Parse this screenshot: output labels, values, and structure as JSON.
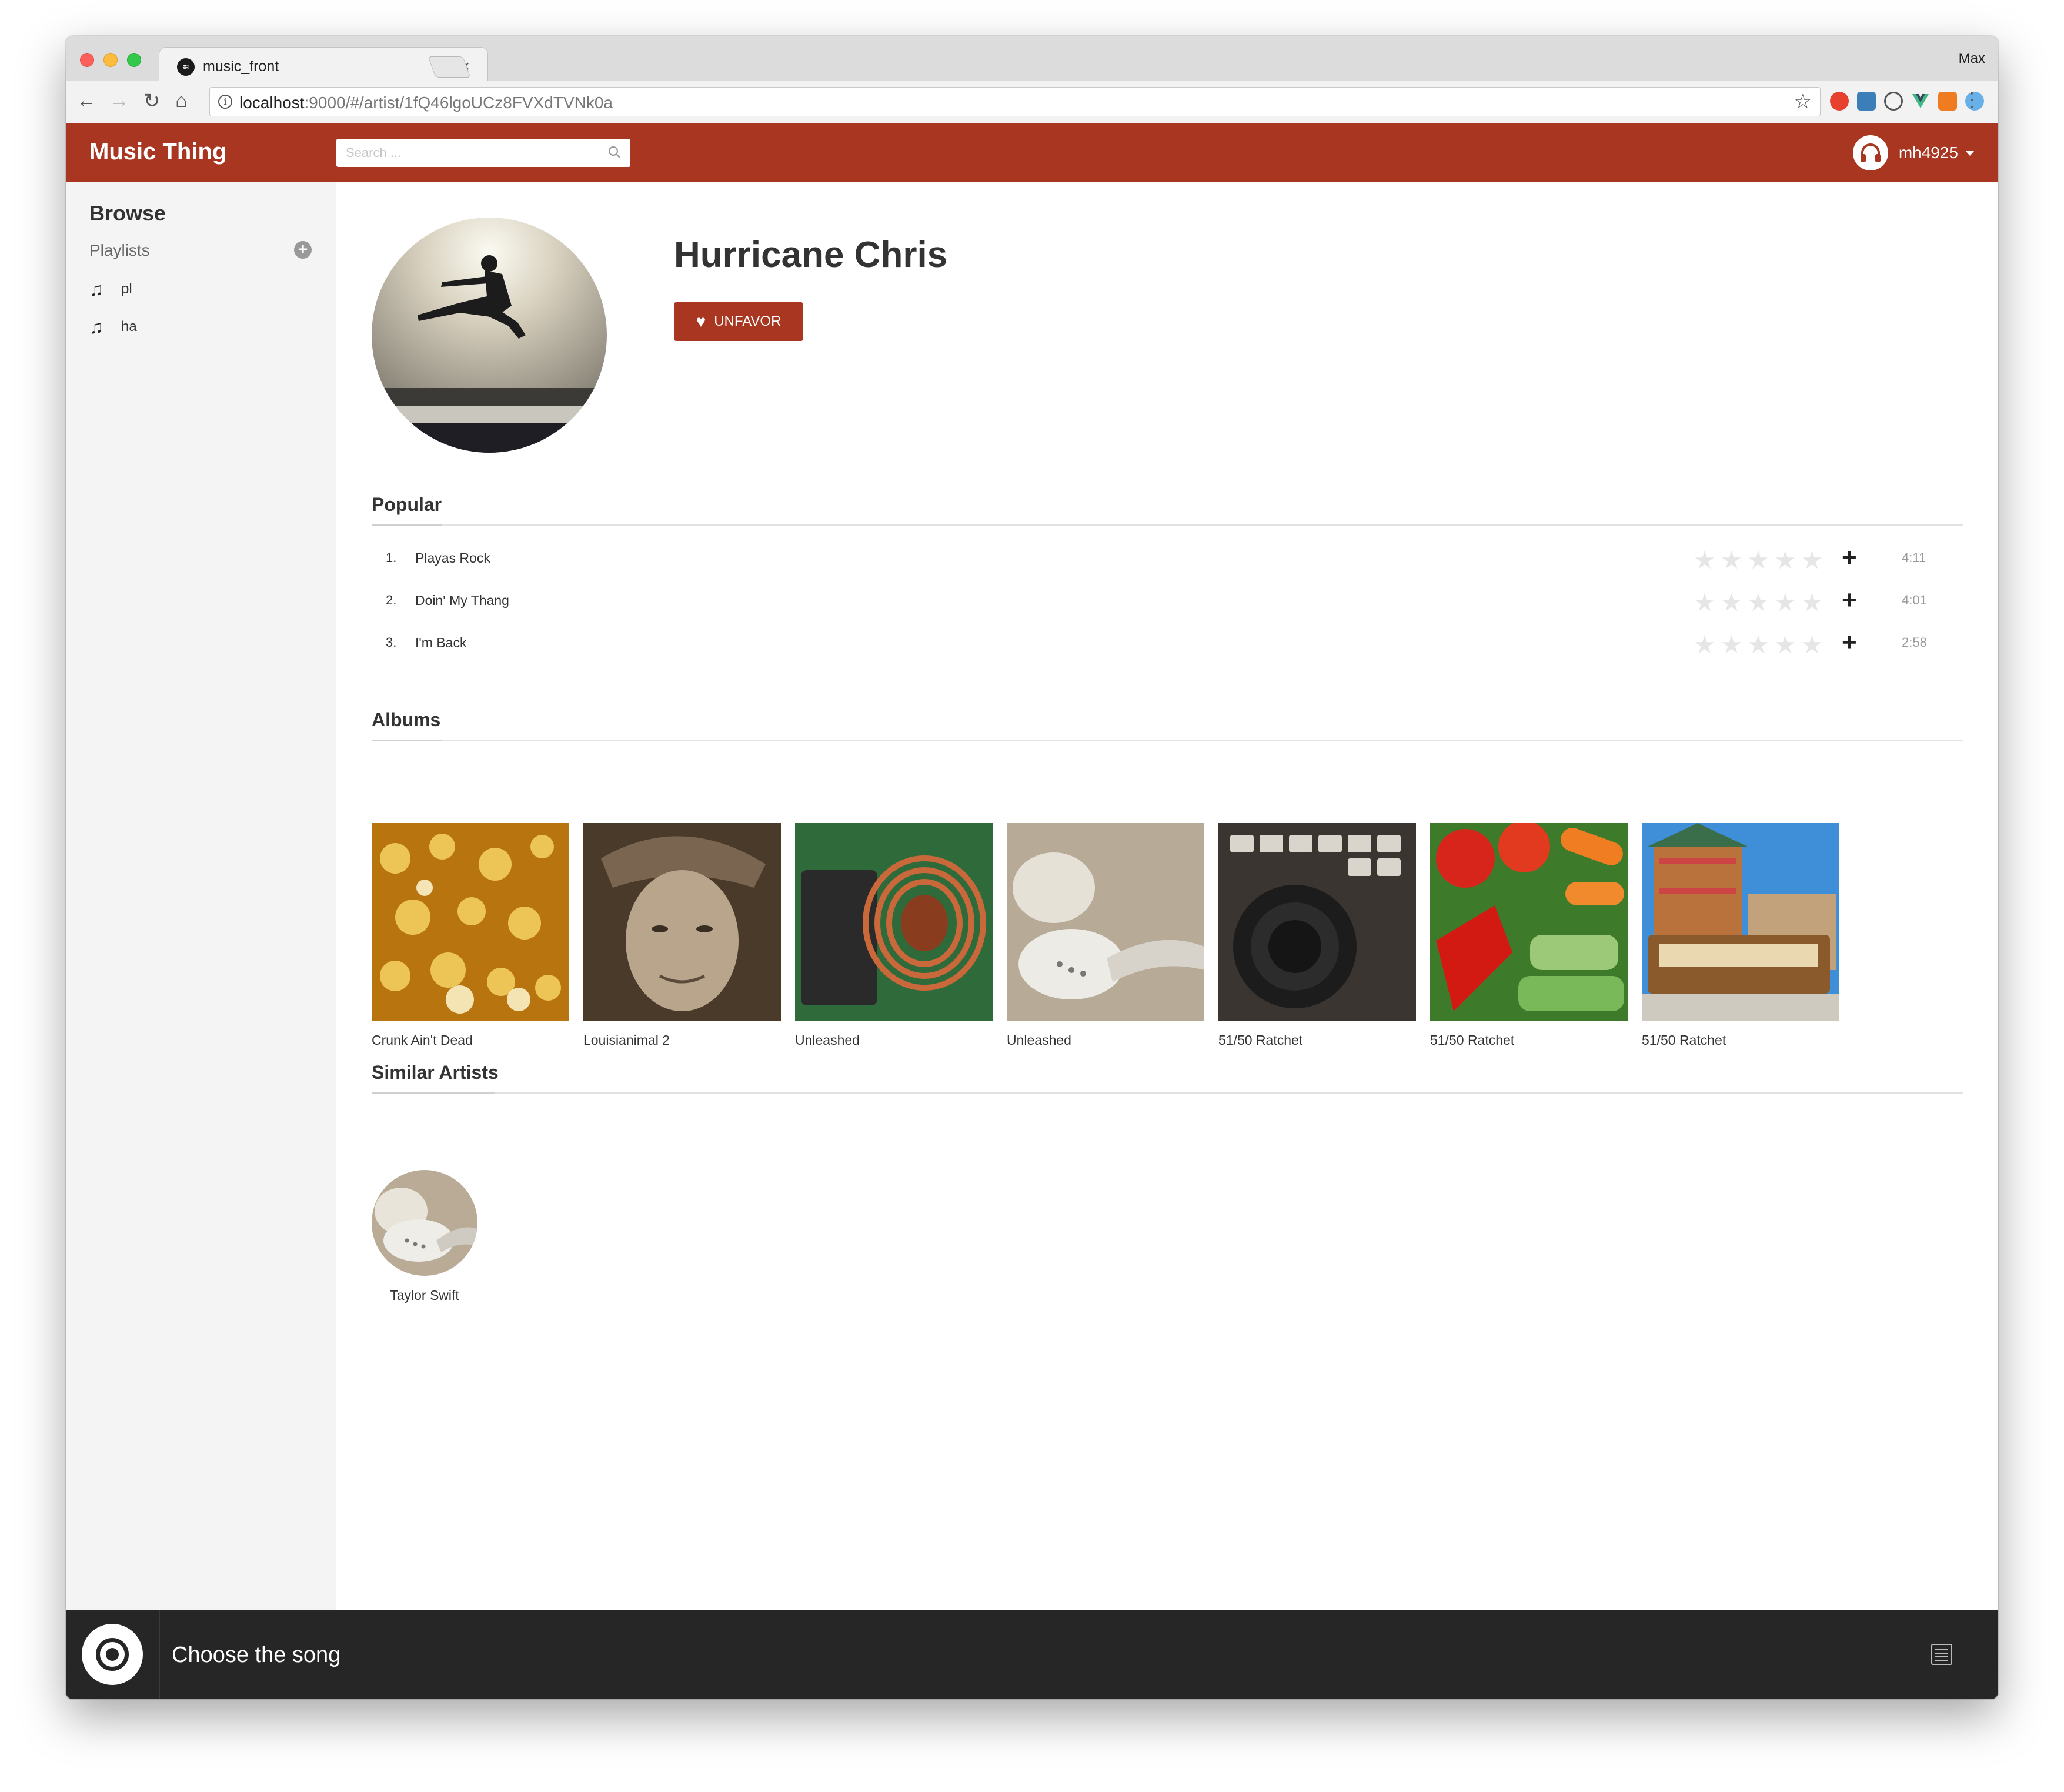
{
  "browser": {
    "tab_title": "music_front",
    "tab_close": "×",
    "profile_name": "Max",
    "url_host": "localhost",
    "url_rest": ":9000/#/artist/1fQ46lgoUCz8FVXdTVNk0a",
    "back": "←",
    "forward": "→",
    "reload": "↻",
    "home": "⌂",
    "star": "☆",
    "menu": "⋮"
  },
  "app": {
    "brand": "Music Thing",
    "search_placeholder": "Search ...",
    "username": "mh4925",
    "accent_color": "#a83621"
  },
  "sidebar": {
    "browse": "Browse",
    "playlists_label": "Playlists",
    "add": "+",
    "items": [
      {
        "icon": "music-note-icon",
        "label": "pl"
      },
      {
        "icon": "music-note-icon",
        "label": "ha"
      }
    ]
  },
  "artist": {
    "name": "Hurricane Chris",
    "unfavor_label": "UNFAVOR"
  },
  "popular": {
    "title": "Popular",
    "tracks": [
      {
        "num": "1.",
        "title": "Playas Rock",
        "stars": "★★★★★",
        "rating": 0,
        "add": "+",
        "duration": "4:11"
      },
      {
        "num": "2.",
        "title": "Doin' My Thang",
        "stars": "★★★★★",
        "rating": 0,
        "add": "+",
        "duration": "4:01"
      },
      {
        "num": "3.",
        "title": "I'm Back",
        "stars": "★★★★★",
        "rating": 0,
        "add": "+",
        "duration": "2:58"
      }
    ]
  },
  "albums": {
    "title": "Albums",
    "items": [
      {
        "name": "Crunk Ain't Dead"
      },
      {
        "name": "Louisianimal 2"
      },
      {
        "name": "Unleashed"
      },
      {
        "name": "Unleashed"
      },
      {
        "name": "51/50 Ratchet"
      },
      {
        "name": "51/50 Ratchet"
      },
      {
        "name": "51/50 Ratchet"
      }
    ]
  },
  "similar": {
    "title": "Similar Artists",
    "items": [
      {
        "name": "Taylor Swift"
      }
    ]
  },
  "player": {
    "status": "Choose the song"
  }
}
